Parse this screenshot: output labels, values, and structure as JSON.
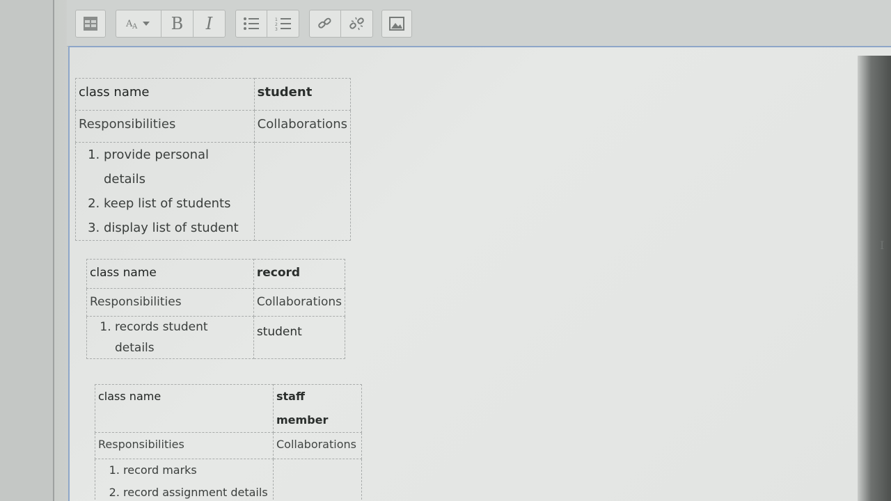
{
  "toolbar": {
    "buttons": [
      {
        "name": "table-icon"
      },
      {
        "name": "font-size-icon",
        "label": "A"
      },
      {
        "name": "bold",
        "label": "B"
      },
      {
        "name": "italic",
        "label": "I"
      },
      {
        "name": "bullet-list-icon"
      },
      {
        "name": "numbered-list-icon"
      },
      {
        "name": "link-icon"
      },
      {
        "name": "unlink-icon"
      },
      {
        "name": "image-icon"
      }
    ]
  },
  "tables": [
    {
      "header_label": "class name",
      "header_value": "student",
      "responsibilities_label": "Responsibilities",
      "collaborations_label": "Collaborations",
      "responsibilities": [
        "provide personal details",
        "keep list of students",
        "display list of student"
      ],
      "collaborations": [
        ""
      ]
    },
    {
      "header_label": "class name",
      "header_value": "record",
      "responsibilities_label": "Responsibilities",
      "collaborations_label": "Collaborations",
      "responsibilities": [
        "records student details"
      ],
      "collaborations": [
        "student"
      ]
    },
    {
      "header_label": "class name",
      "header_value": "staff member",
      "responsibilities_label": "Responsibilities",
      "collaborations_label": "Collaborations",
      "responsibilities": [
        "record marks",
        "record assignment details"
      ],
      "collaborations": [
        ""
      ]
    }
  ],
  "cursor_glyph": "I"
}
